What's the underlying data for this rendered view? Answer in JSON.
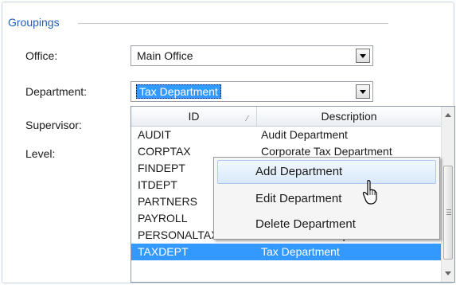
{
  "groupings": {
    "title": "Groupings"
  },
  "form": {
    "office_label": "Office:",
    "office_value": "Main Office",
    "department_label": "Department:",
    "department_value": "Tax Department",
    "supervisor_label": "Supervisor:",
    "level_label": "Level:"
  },
  "dropdown": {
    "columns": [
      "ID",
      "Description"
    ],
    "rows": [
      {
        "id": "AUDIT",
        "description": "Audit Department"
      },
      {
        "id": "CORPTAX",
        "description": "Corporate Tax Department"
      },
      {
        "id": "FINDEPT",
        "description": ""
      },
      {
        "id": "ITDEPT",
        "description": ""
      },
      {
        "id": "PARTNERS",
        "description": ""
      },
      {
        "id": "PAYROLL",
        "description": ""
      },
      {
        "id": "PERSONALTAX",
        "description": "Personal Tax Department"
      },
      {
        "id": "TAXDEPT",
        "description": "Tax Department"
      }
    ],
    "selected_row": "TAXDEPT"
  },
  "context_menu": {
    "items": [
      "Add Department",
      "Edit Department",
      "Delete Department"
    ],
    "hovered": "Add Department"
  },
  "icons": {
    "combo_button": "chevron-down-icon",
    "sort": "sort-indicator-icon",
    "scroll_up": "scroll-up-arrow-icon",
    "scroll_down": "scroll-down-arrow-icon",
    "cursor": "mouse-pointer-icon"
  },
  "colors": {
    "accent": "#1f5fbf",
    "selection": "#3399ff",
    "menu_hover": "#d9e9fb"
  }
}
